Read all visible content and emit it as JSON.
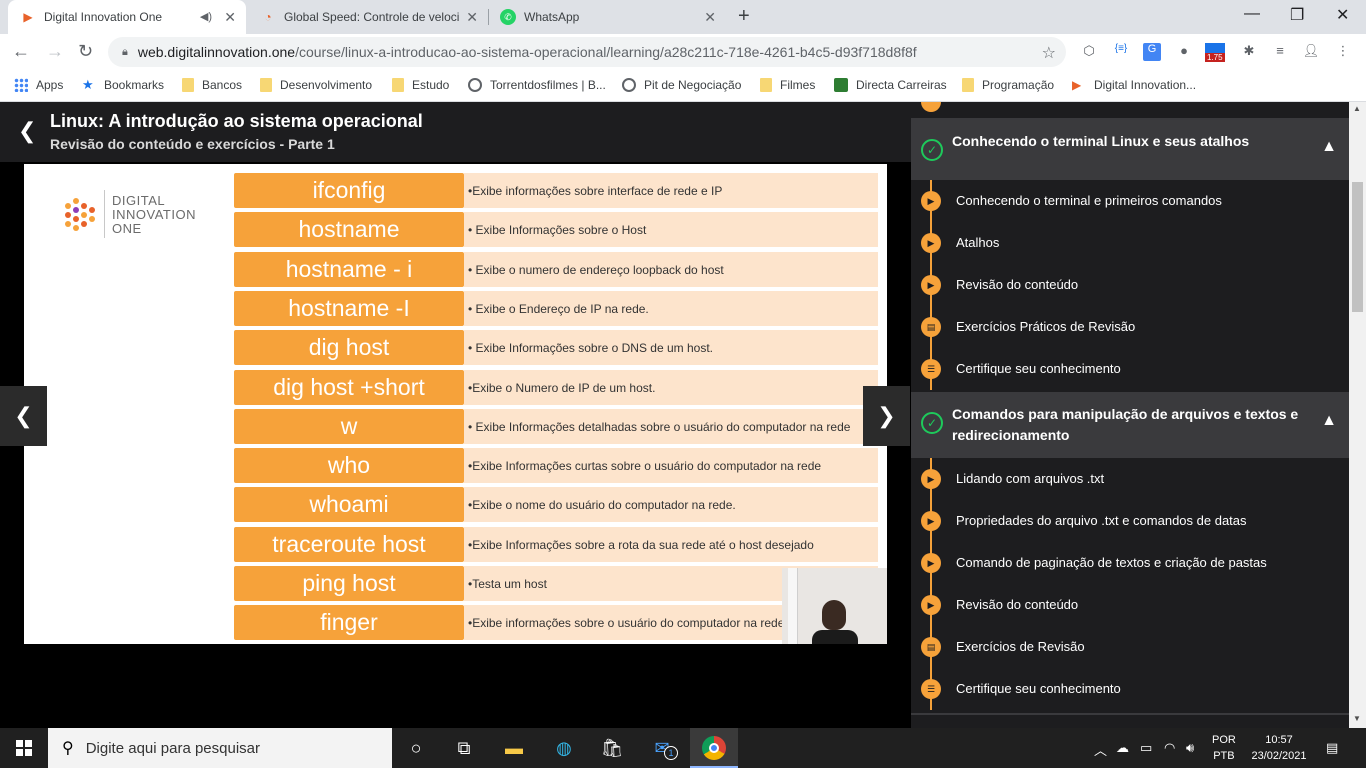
{
  "tabs": [
    {
      "title": "Digital Innovation One",
      "active": true
    },
    {
      "title": "Global Speed: Controle de veloci",
      "active": false
    },
    {
      "title": "WhatsApp",
      "active": false
    }
  ],
  "toolbar": {
    "url_host": "web.digitalinnovation.one",
    "url_path": "/course/linux-a-introducao-ao-sistema-operacional/learning/a28c211c-718e-4261-b4c5-d93f718d8f8f",
    "ext_speed": "1.75"
  },
  "bookmarks": [
    "Apps",
    "Bookmarks",
    "Bancos",
    "Desenvolvimento",
    "Estudo",
    "Torrentdosfilmes | B...",
    "Pit de Negociação",
    "Filmes",
    "Directa Carreiras",
    "Programação",
    "Digital Innovation..."
  ],
  "course": {
    "title": "Linux: A introdução ao sistema operacional",
    "subtitle": "Revisão do conteúdo e exercícios - Parte 1"
  },
  "slide": {
    "logo_line1": "DIGITAL",
    "logo_line2": "INNOVATION",
    "logo_line3": "ONE",
    "rows": [
      {
        "cmd": "ifconfig",
        "desc": "•Exibe informações sobre interface de rede e IP"
      },
      {
        "cmd": "hostname",
        "desc": "• Exibe Informações sobre o Host"
      },
      {
        "cmd": "hostname - i",
        "desc": "• Exibe o numero de endereço loopback do host"
      },
      {
        "cmd": "hostname -I",
        "desc": "• Exibe o Endereço de IP na rede."
      },
      {
        "cmd": "dig host",
        "desc": "• Exibe Informações sobre o DNS de um host."
      },
      {
        "cmd": "dig host +short",
        "desc": "•Exibe o Numero de IP de um host."
      },
      {
        "cmd": "w",
        "desc": "• Exibe Informações detalhadas sobre o usuário do computador na rede"
      },
      {
        "cmd": "who",
        "desc": "•Exibe Informações curtas sobre o usuário do computador na rede"
      },
      {
        "cmd": "whoami",
        "desc": "•Exibe o nome do usuário do computador na rede."
      },
      {
        "cmd": "traceroute host",
        "desc": "•Exibe Informações sobre a rota da sua rede até o host desejado"
      },
      {
        "cmd": "ping host",
        "desc": "•Testa um host"
      },
      {
        "cmd": "finger",
        "desc": "•Exibe informações sobre o usuário do computador na rede"
      }
    ]
  },
  "sidebar": {
    "sections": [
      {
        "title": "Conhecendo o terminal Linux e seus atalhos",
        "lessons": [
          {
            "label": "Conhecendo o terminal e primeiros comandos",
            "icon": "play-icon"
          },
          {
            "label": "Atalhos",
            "icon": "play-icon"
          },
          {
            "label": "Revisão do conteúdo",
            "icon": "play-icon"
          },
          {
            "label": "Exercícios Práticos de Revisão",
            "icon": "document-icon"
          },
          {
            "label": "Certifique seu conhecimento",
            "icon": "list-icon"
          }
        ]
      },
      {
        "title": "Comandos para manipulação de arquivos e textos e redirecionamento",
        "lessons": [
          {
            "label": "Lidando com arquivos .txt",
            "icon": "play-icon"
          },
          {
            "label": "Propriedades do arquivo .txt e comandos de datas",
            "icon": "play-icon"
          },
          {
            "label": "Comando de paginação de textos e criação de pastas",
            "icon": "play-icon"
          },
          {
            "label": "Revisão do conteúdo",
            "icon": "play-icon"
          },
          {
            "label": "Exercícios de Revisão",
            "icon": "document-icon"
          },
          {
            "label": "Certifique seu conhecimento",
            "icon": "list-icon"
          }
        ]
      }
    ]
  },
  "taskbar": {
    "search_placeholder": "Digite aqui para pesquisar",
    "lang1": "POR",
    "lang2": "PTB",
    "time": "10:57",
    "date": "23/02/2021",
    "mail_badge": "1"
  },
  "colors": {
    "accent_orange": "#f6a23a",
    "check_green": "#1ec95b",
    "sidebar_bg": "#1d1d1f",
    "section_bg": "#3a3a3d"
  }
}
